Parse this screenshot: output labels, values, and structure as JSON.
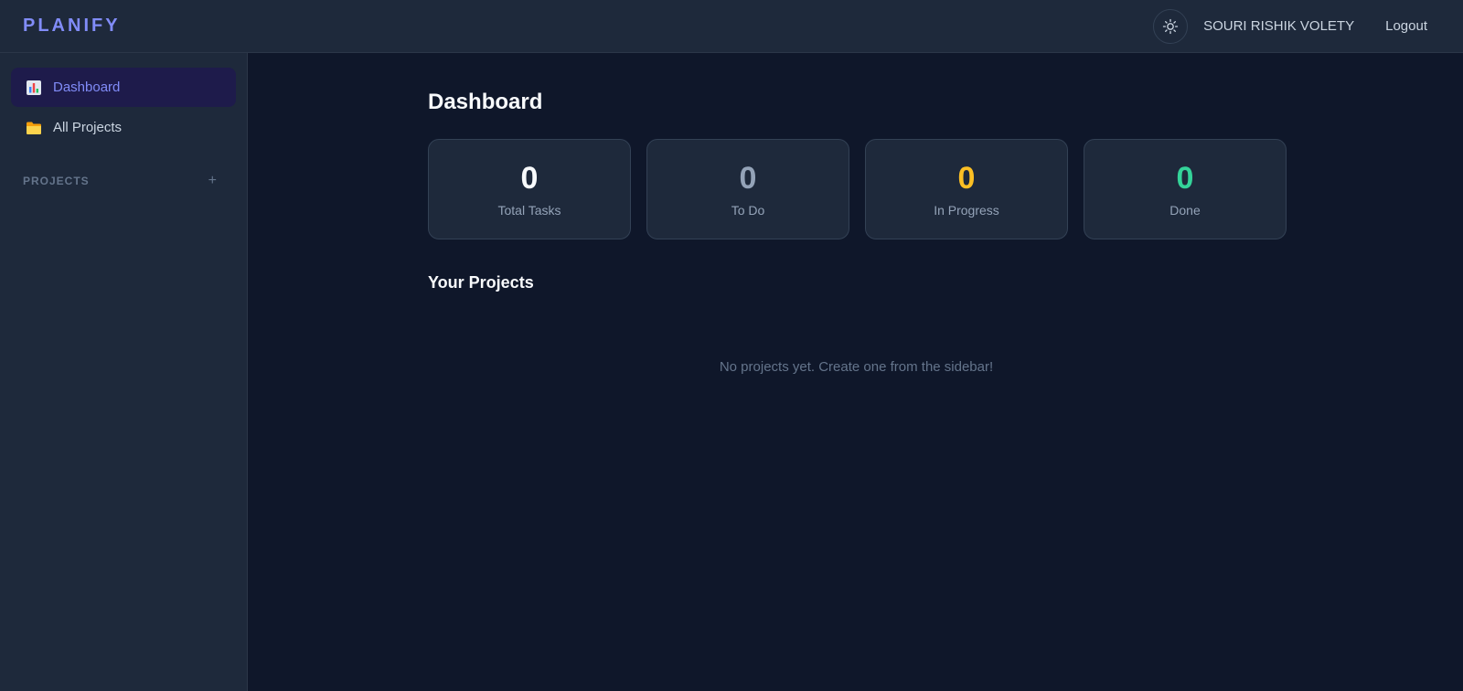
{
  "header": {
    "brand": "PLANIFY",
    "theme_toggle_icon": "sun-icon",
    "user_name": "SOURI RISHIK VOLETY",
    "logout_label": "Logout"
  },
  "sidebar": {
    "items": [
      {
        "label": "Dashboard",
        "icon": "bar-chart-icon",
        "active": true
      },
      {
        "label": "All Projects",
        "icon": "folder-icon",
        "active": false
      }
    ],
    "projects_heading": "PROJECTS",
    "add_label": "+"
  },
  "main": {
    "title": "Dashboard",
    "stats": [
      {
        "value": "0",
        "label": "Total Tasks",
        "color": "#f8fafc"
      },
      {
        "value": "0",
        "label": "To Do",
        "color": "#94a3b8"
      },
      {
        "value": "0",
        "label": "In Progress",
        "color": "#fbbf24"
      },
      {
        "value": "0",
        "label": "Done",
        "color": "#34d399"
      }
    ],
    "projects_title": "Your Projects",
    "empty_message": "No projects yet. Create one from the sidebar!"
  },
  "colors": {
    "accent": "#818cf8",
    "background": "#0f172a",
    "surface": "#1e293b"
  }
}
